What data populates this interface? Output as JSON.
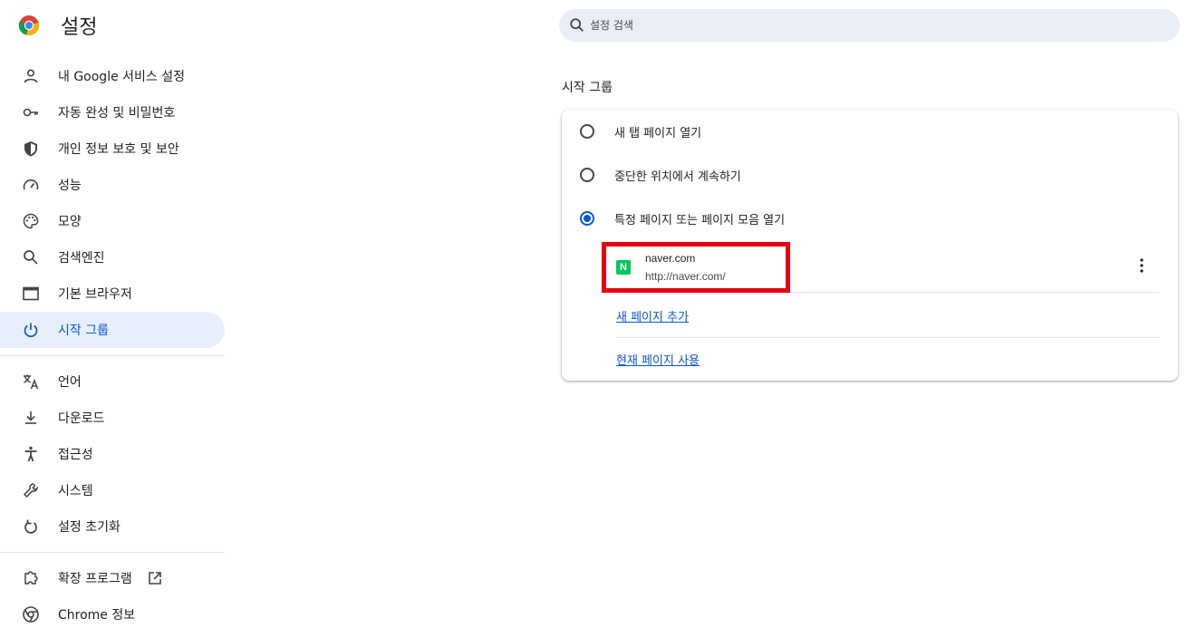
{
  "app": {
    "title": "설정"
  },
  "search": {
    "placeholder": "설정 검색"
  },
  "sidebar": {
    "items": [
      {
        "label": "내 Google 서비스 설정",
        "icon": "person-icon"
      },
      {
        "label": "자동 완성 및 비밀번호",
        "icon": "key-icon"
      },
      {
        "label": "개인 정보 보호 및 보안",
        "icon": "shield-icon"
      },
      {
        "label": "성능",
        "icon": "speedometer-icon"
      },
      {
        "label": "모양",
        "icon": "palette-icon"
      },
      {
        "label": "검색엔진",
        "icon": "search-icon"
      },
      {
        "label": "기본 브라우저",
        "icon": "browser-window-icon"
      },
      {
        "label": "시작 그룹",
        "icon": "power-icon",
        "active": true
      }
    ],
    "items2": [
      {
        "label": "언어",
        "icon": "translate-icon"
      },
      {
        "label": "다운로드",
        "icon": "download-icon"
      },
      {
        "label": "접근성",
        "icon": "accessibility-icon"
      },
      {
        "label": "시스템",
        "icon": "wrench-icon"
      },
      {
        "label": "설정 초기화",
        "icon": "reset-icon"
      }
    ],
    "items3": [
      {
        "label": "확장 프로그램",
        "icon": "puzzle-icon"
      },
      {
        "label": "Chrome 정보",
        "icon": "chrome-icon"
      }
    ]
  },
  "main": {
    "section_title": "시작 그룹",
    "options": [
      {
        "label": "새 탭 페이지 열기",
        "checked": false
      },
      {
        "label": "중단한 위치에서 계속하기",
        "checked": false
      },
      {
        "label": "특정 페이지 또는 페이지 모음 열기",
        "checked": true
      }
    ],
    "pages": [
      {
        "name": "naver.com",
        "url": "http://naver.com/",
        "favicon": "N"
      }
    ],
    "add_page_label": "새 페이지 추가",
    "use_current_label": "현재 페이지 사용"
  },
  "colors": {
    "accent": "#0b57d0",
    "active_bg": "#e7effd",
    "search_bg": "#e9eef6",
    "highlight": "#e60012",
    "naver_green": "#03c75a"
  }
}
